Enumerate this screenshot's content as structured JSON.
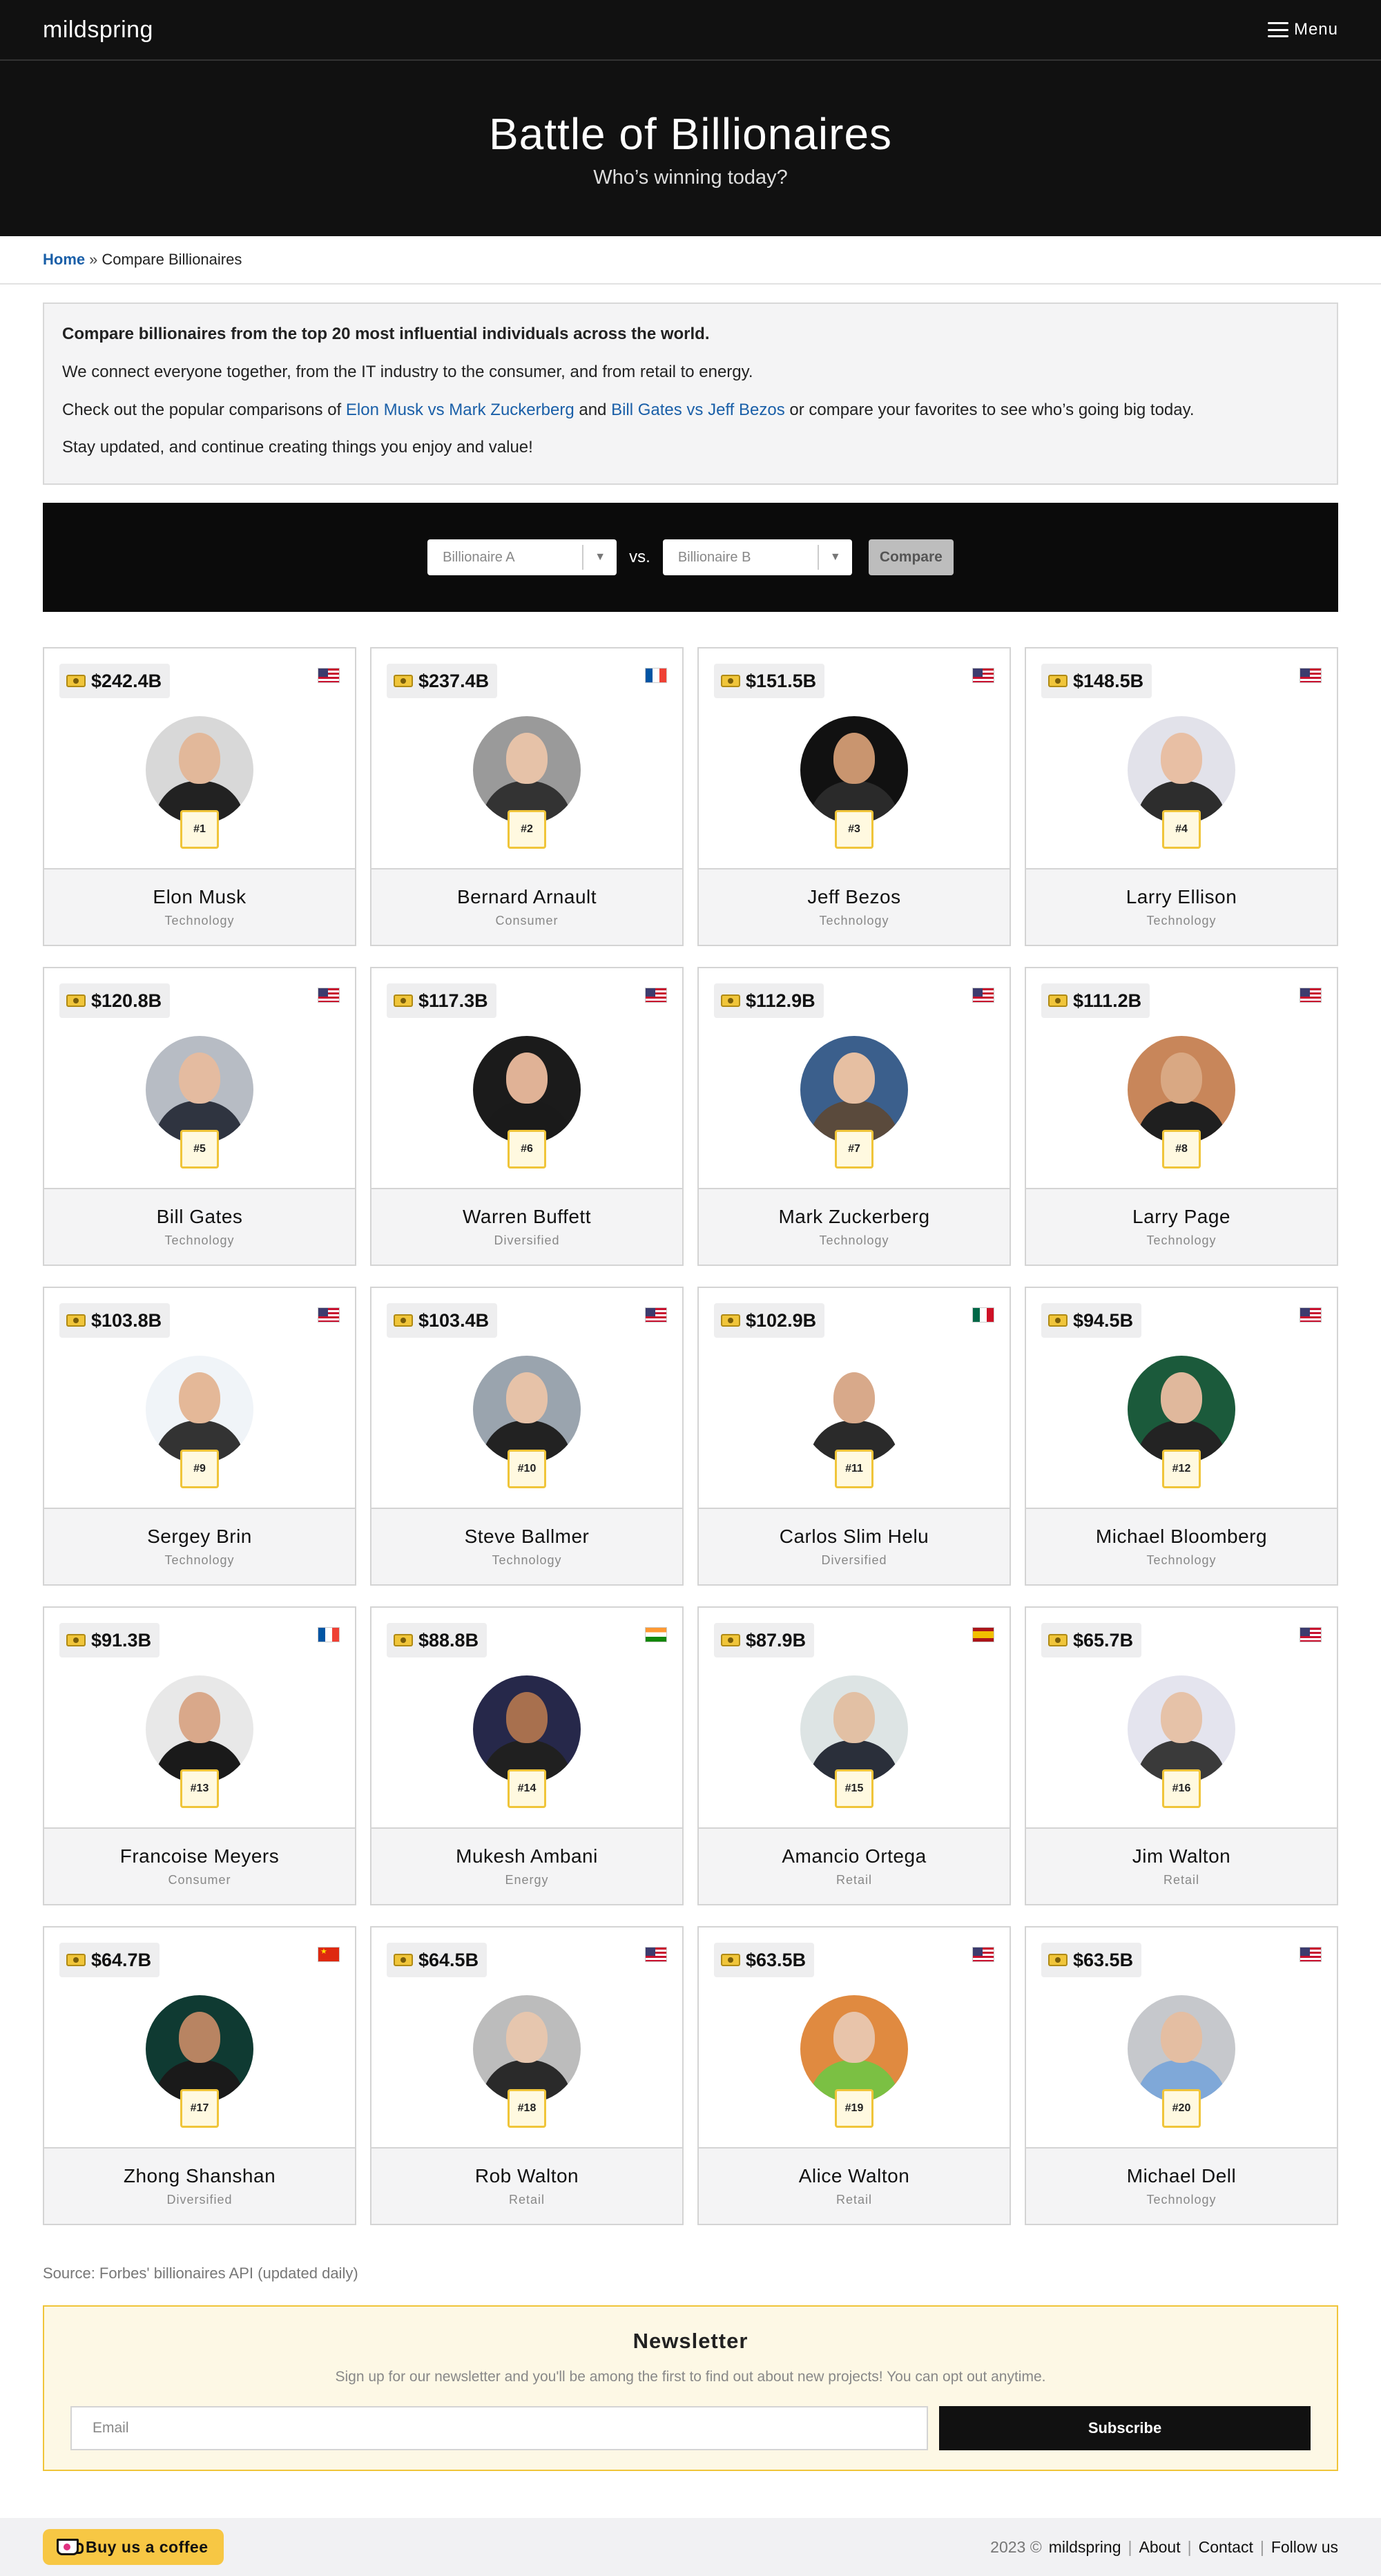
{
  "nav": {
    "logo": "mildspring",
    "menu_label": "Menu",
    "menu_icon": "hamburger-icon"
  },
  "hero": {
    "title": "Battle of Billionaires",
    "subtitle": "Who’s winning today?"
  },
  "breadcrumb": {
    "home": "Home",
    "separator": "»",
    "current": "Compare Billionaires"
  },
  "intro": {
    "lead": "Compare billionaires from the top 20 most influential individuals across the world.",
    "line2": "We connect everyone together, from the IT industry to the consumer, and from retail to energy.",
    "line3_prefix": "Check out the popular comparisons of",
    "link1": "Elon Musk vs Mark Zuckerberg",
    "line3_and": "and",
    "link2": "Bill Gates vs Jeff Bezos",
    "line3_suffix": "or compare your favorites to see who’s going big today.",
    "line4": "Stay updated, and continue creating things you enjoy and value!"
  },
  "compare": {
    "select_a": "Billionaire A",
    "vs": "vs.",
    "select_b": "Billionaire B",
    "button": "Compare"
  },
  "billionaires": [
    {
      "worth": "$242.4B",
      "flag": "us",
      "rank": "#1",
      "name": "Elon Musk",
      "industry": "Technology"
    },
    {
      "worth": "$237.4B",
      "flag": "fr",
      "rank": "#2",
      "name": "Bernard Arnault",
      "industry": "Consumer"
    },
    {
      "worth": "$151.5B",
      "flag": "us",
      "rank": "#3",
      "name": "Jeff Bezos",
      "industry": "Technology"
    },
    {
      "worth": "$148.5B",
      "flag": "us",
      "rank": "#4",
      "name": "Larry Ellison",
      "industry": "Technology"
    },
    {
      "worth": "$120.8B",
      "flag": "us",
      "rank": "#5",
      "name": "Bill Gates",
      "industry": "Technology"
    },
    {
      "worth": "$117.3B",
      "flag": "us",
      "rank": "#6",
      "name": "Warren Buffett",
      "industry": "Diversified"
    },
    {
      "worth": "$112.9B",
      "flag": "us",
      "rank": "#7",
      "name": "Mark Zuckerberg",
      "industry": "Technology"
    },
    {
      "worth": "$111.2B",
      "flag": "us",
      "rank": "#8",
      "name": "Larry Page",
      "industry": "Technology"
    },
    {
      "worth": "$103.8B",
      "flag": "us",
      "rank": "#9",
      "name": "Sergey Brin",
      "industry": "Technology"
    },
    {
      "worth": "$103.4B",
      "flag": "us",
      "rank": "#10",
      "name": "Steve Ballmer",
      "industry": "Technology"
    },
    {
      "worth": "$102.9B",
      "flag": "mx",
      "rank": "#11",
      "name": "Carlos Slim Helu",
      "industry": "Diversified"
    },
    {
      "worth": "$94.5B",
      "flag": "us",
      "rank": "#12",
      "name": "Michael Bloomberg",
      "industry": "Technology"
    },
    {
      "worth": "$91.3B",
      "flag": "fr",
      "rank": "#13",
      "name": "Francoise Meyers",
      "industry": "Consumer"
    },
    {
      "worth": "$88.8B",
      "flag": "in",
      "rank": "#14",
      "name": "Mukesh Ambani",
      "industry": "Energy"
    },
    {
      "worth": "$87.9B",
      "flag": "es",
      "rank": "#15",
      "name": "Amancio Ortega",
      "industry": "Retail"
    },
    {
      "worth": "$65.7B",
      "flag": "us",
      "rank": "#16",
      "name": "Jim Walton",
      "industry": "Retail"
    },
    {
      "worth": "$64.7B",
      "flag": "cn",
      "rank": "#17",
      "name": "Zhong Shanshan",
      "industry": "Diversified"
    },
    {
      "worth": "$64.5B",
      "flag": "us",
      "rank": "#18",
      "name": "Rob Walton",
      "industry": "Retail"
    },
    {
      "worth": "$63.5B",
      "flag": "us",
      "rank": "#19",
      "name": "Alice Walton",
      "industry": "Retail"
    },
    {
      "worth": "$63.5B",
      "flag": "us",
      "rank": "#20",
      "name": "Michael Dell",
      "industry": "Technology"
    }
  ],
  "source": "Source: Forbes' billionaires API (updated daily)",
  "newsletter": {
    "title": "Newsletter",
    "text": "Sign up for our newsletter and you'll be among the first to find out about new projects! You can opt out anytime.",
    "email_placeholder": "Email",
    "button": "Subscribe"
  },
  "footer": {
    "coffee": "Buy us a coffee",
    "copyright": "2023 ©",
    "brand": "mildspring",
    "sep": "|",
    "links": [
      "About",
      "Contact",
      "Follow us"
    ]
  },
  "colors": {
    "accent": "#f0c53a",
    "link": "#1a5fa8",
    "dark": "#111111"
  }
}
